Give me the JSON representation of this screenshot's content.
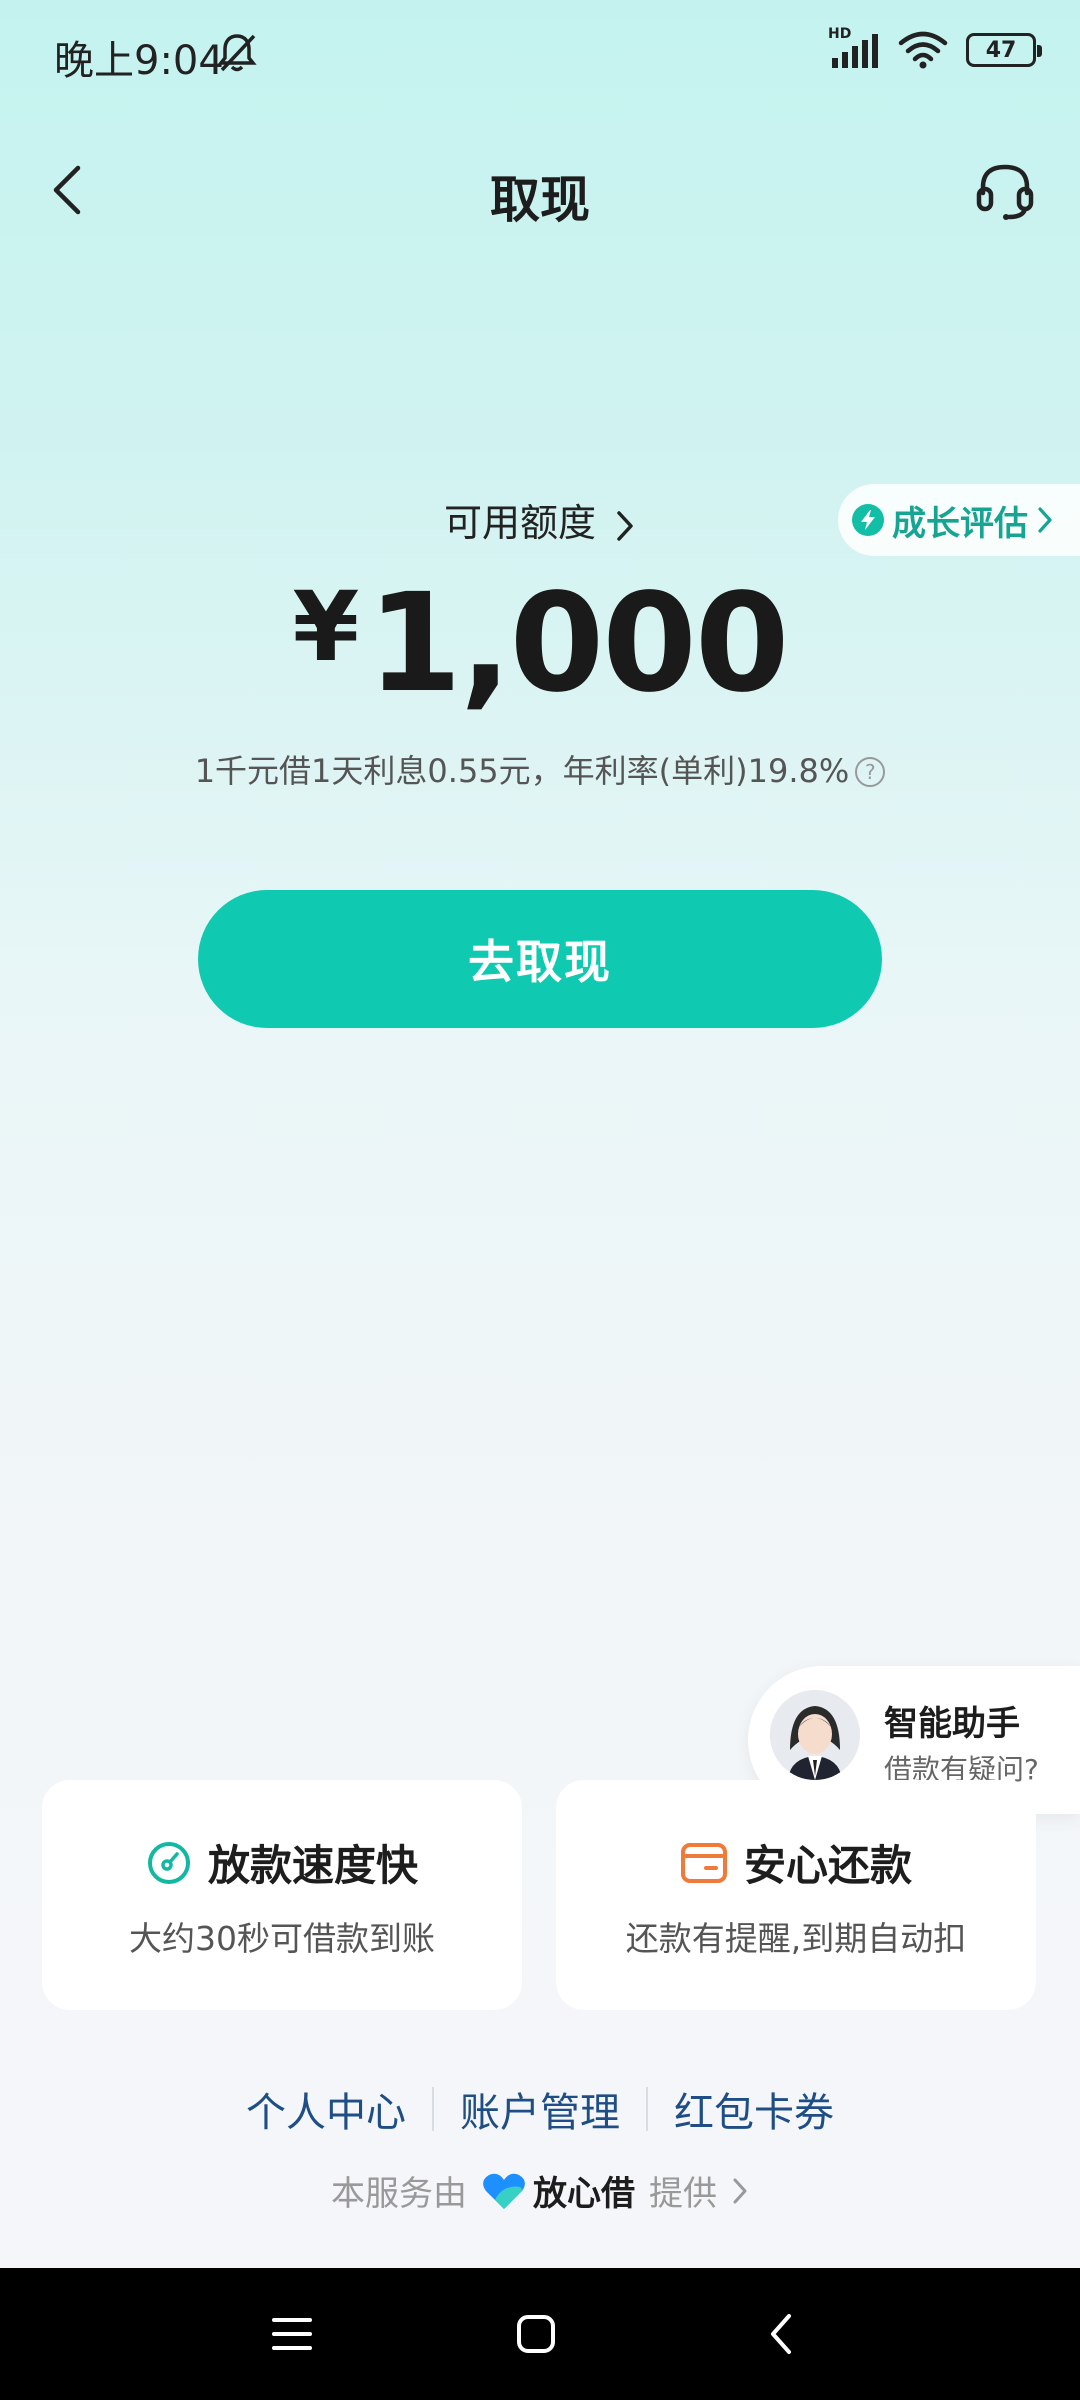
{
  "status_bar": {
    "time": "晚上9:04",
    "network": "HD",
    "battery": "47",
    "icons": [
      "mute-icon",
      "signal-icon",
      "wifi-icon",
      "battery-icon"
    ]
  },
  "header": {
    "title": "取现",
    "back_icon": "back-arrow-icon",
    "support_icon": "headset-icon"
  },
  "credit": {
    "label": "可用额度",
    "currency": "¥",
    "amount": "1,000",
    "rate_text": "1千元借1天利息0.55元，年利率(单利)19.8%",
    "growth_label": "成长评估"
  },
  "action": {
    "withdraw_label": "去取现"
  },
  "assistant": {
    "title": "智能助手",
    "subtitle": "借款有疑问?"
  },
  "features": [
    {
      "title": "放款速度快",
      "subtitle": "大约30秒可借款到账",
      "icon": "speed-gauge-icon",
      "color": "#12b8a0"
    },
    {
      "title": "安心还款",
      "subtitle": "还款有提醒,到期自动扣",
      "icon": "wallet-icon",
      "color": "#f07a3a"
    }
  ],
  "links": [
    "个人中心",
    "账户管理",
    "红包卡券"
  ],
  "provider": {
    "prefix": "本服务由",
    "brand": "放心借",
    "suffix": "提供"
  },
  "colors": {
    "accent": "#0fcab0",
    "link": "#1f4e86",
    "brand_teal": "#16a592"
  }
}
